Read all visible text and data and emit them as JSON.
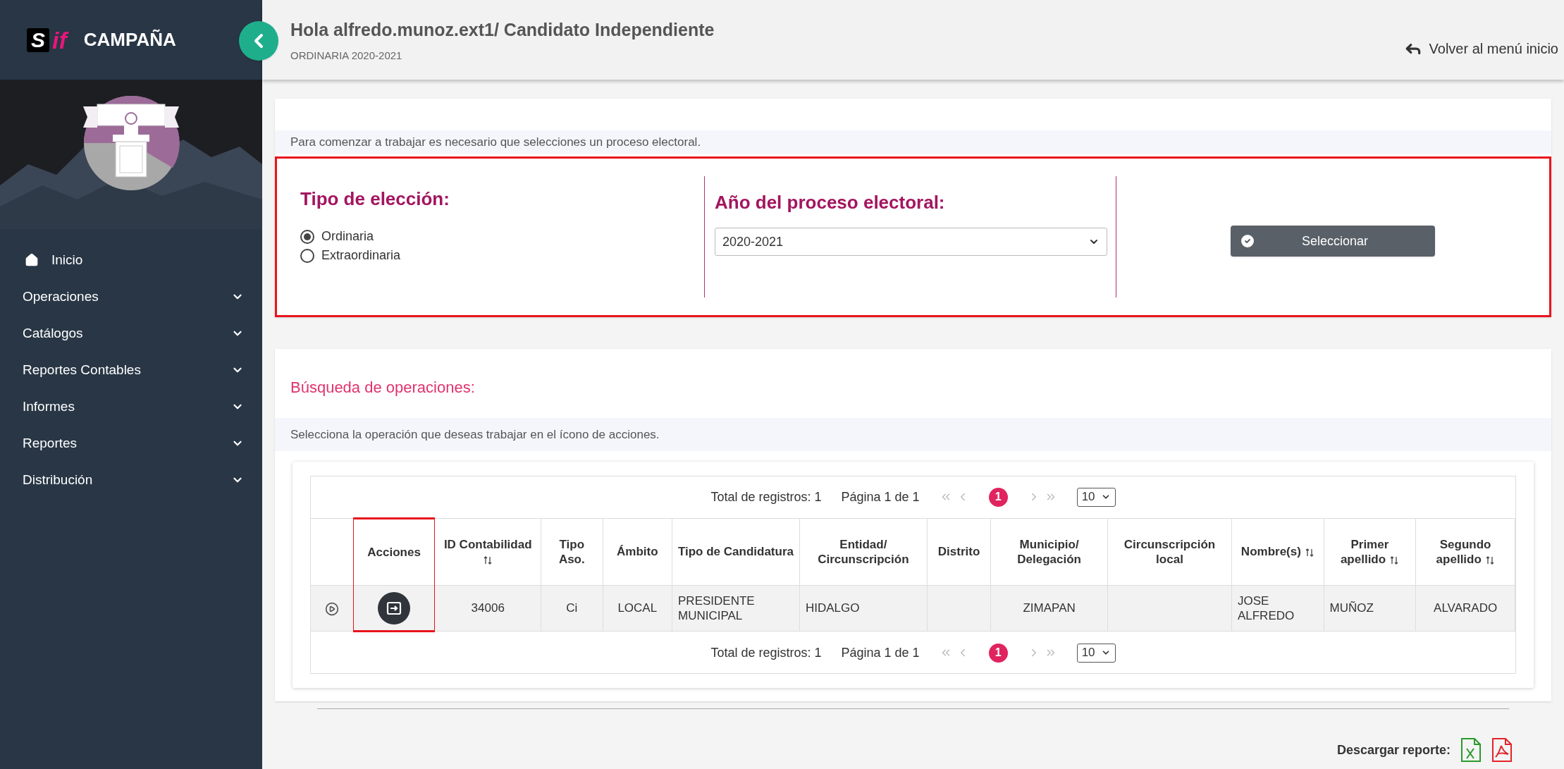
{
  "sidebar": {
    "logo": {
      "mark": "S",
      "accent": "if"
    },
    "brand": "CAMPAÑA",
    "items": [
      {
        "label": "Inicio",
        "kind": "link"
      },
      {
        "label": "Operaciones",
        "kind": "dropdown",
        "expanded": false
      },
      {
        "label": "Catálogos",
        "kind": "dropdown",
        "expanded": false
      },
      {
        "label": "Reportes Contables",
        "kind": "dropdown",
        "expanded": false
      },
      {
        "label": "Informes",
        "kind": "dropdown",
        "expanded": false
      },
      {
        "label": "Reportes",
        "kind": "dropdown",
        "expanded": false
      },
      {
        "label": "Distribución",
        "kind": "dropdown",
        "expanded": false
      }
    ]
  },
  "header": {
    "greeting": "Hola alfredo.munoz.ext1/ Candidato Independiente",
    "subtitle": "ORDINARIA 2020-2021",
    "back_link": "Volver al menú inicio"
  },
  "selection": {
    "intro": "Para comenzar a trabajar es necesario que selecciones un proceso electoral.",
    "election_type": {
      "label": "Tipo de elección:",
      "options": [
        {
          "label": "Ordinaria",
          "selected": true
        },
        {
          "label": "Extraordinaria",
          "selected": false
        }
      ]
    },
    "year": {
      "label": "Año del proceso electoral:",
      "value": "2020-2021"
    },
    "button": "Seleccionar"
  },
  "search": {
    "title": "Búsqueda de operaciones:",
    "hint": "Selecciona la operación que deseas trabajar en el ícono de acciones.",
    "pagination_top": {
      "total": "Total de registros: 1",
      "page": "Página 1 de 1",
      "current": "1",
      "page_size": "10"
    },
    "columns": [
      {
        "kind": "action",
        "label": "Acciones",
        "sortable": false,
        "highlighted": true
      },
      {
        "kind": "text",
        "label": "ID Contabilidad",
        "sortable": true,
        "highlighted": false
      },
      {
        "kind": "text",
        "label": "Tipo Aso.",
        "sortable": false,
        "highlighted": false
      },
      {
        "kind": "text",
        "label": "Ámbito",
        "sortable": false,
        "highlighted": false
      },
      {
        "kind": "text",
        "label": "Tipo de Candidatura",
        "sortable": false,
        "highlighted": false
      },
      {
        "kind": "text",
        "label": "Entidad/ Circunscripción",
        "sortable": false,
        "highlighted": false
      },
      {
        "kind": "text",
        "label": "Distrito",
        "sortable": false,
        "highlighted": false
      },
      {
        "kind": "text",
        "label": "Municipio/ Delegación",
        "sortable": false,
        "highlighted": false
      },
      {
        "kind": "text",
        "label": "Circunscripción local",
        "sortable": false,
        "highlighted": false
      },
      {
        "kind": "text",
        "label": "Nombre(s)",
        "sortable": true,
        "highlighted": false
      },
      {
        "kind": "text",
        "label": "Primer apellido",
        "sortable": true,
        "highlighted": false
      },
      {
        "kind": "text",
        "label": "Segundo apellido",
        "sortable": true,
        "highlighted": false
      }
    ],
    "rows": [
      {
        "cells": [
          null,
          "34006",
          "Ci",
          "LOCAL",
          "PRESIDENTE MUNICIPAL",
          "HIDALGO",
          null,
          "ZIMAPAN",
          null,
          "JOSE ALFREDO",
          "MUÑOZ",
          "ALVARADO"
        ]
      }
    ],
    "pagination_bottom": {
      "total": "Total de registros: 1",
      "page": "Página 1 de 1",
      "current": "1",
      "page_size": "10"
    }
  },
  "download": {
    "label": "Descargar reporte:"
  }
}
